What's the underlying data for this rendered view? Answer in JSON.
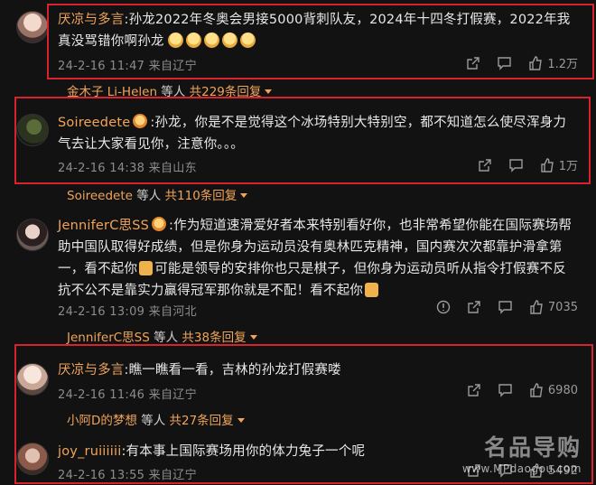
{
  "comments": [
    {
      "user": "厌凉与多言",
      "text": ":孙龙2022年冬奥会男接5000背刺队友，2024年十四冬打假赛，2022年我真没骂错你啊孙龙",
      "emojis": [
        "crying-face",
        "crying-face",
        "crying-face",
        "crying-face",
        "crying-face"
      ],
      "time": "24-2-16 11:47 来自辽宁",
      "likes": "1.2万"
    },
    {
      "user": "Soireedete",
      "text": ":孙龙，你是不是觉得这个冰场特别大特别空，都不知道怎么使尽浑身力气去让大家看见你，注意你。。。",
      "time": "24-2-16 14:38 来自山东",
      "likes": "1万"
    },
    {
      "user": "JenniferC思SS",
      "text_a": ":作为短道速滑爱好者本来特别看好你，也非常希望你能在国际赛场帮助中国队取得好成绩，但是你身为运动员没有奥林匹克精神，国内赛次次都靠护滑拿第一，看不起你",
      "text_b": "可能是领导的安排你也只是棋子，但你身为运动员听从指令打假赛不反抗不公不是靠实力赢得冠军那你就是不配！看不起你",
      "time": "24-2-16 13:09 来自河北",
      "likes": "7035"
    },
    {
      "user": "厌凉与多言",
      "text": ":瞧一瞧看一看，吉林的孙龙打假赛喽",
      "time": "24-2-16 11:46 来自辽宁",
      "likes": "6980"
    },
    {
      "user": "joy_ruiiiiii",
      "text": ":有本事上国际赛场用你的体力兔子一个呢",
      "time": "24-2-16 13:55 来自辽宁",
      "likes": "5492"
    }
  ],
  "replies": [
    {
      "names": "金木子  Li-Helen",
      "mid": " 等人 ",
      "count": "共229条回复"
    },
    {
      "names": "Soireedete",
      "mid": " 等人 ",
      "count": "共110条回复"
    },
    {
      "names": "JenniferC思SS",
      "mid": " 等人 ",
      "count": "共38条回复"
    },
    {
      "names": "小阿D的梦想",
      "mid": " 等人 ",
      "count": "共27条回复"
    }
  ],
  "watermark": {
    "title": "名品导购",
    "url": "www.MPdaogou.com"
  },
  "colors": {
    "highlight_box": "#d6232d",
    "username": "#f0a45b"
  }
}
